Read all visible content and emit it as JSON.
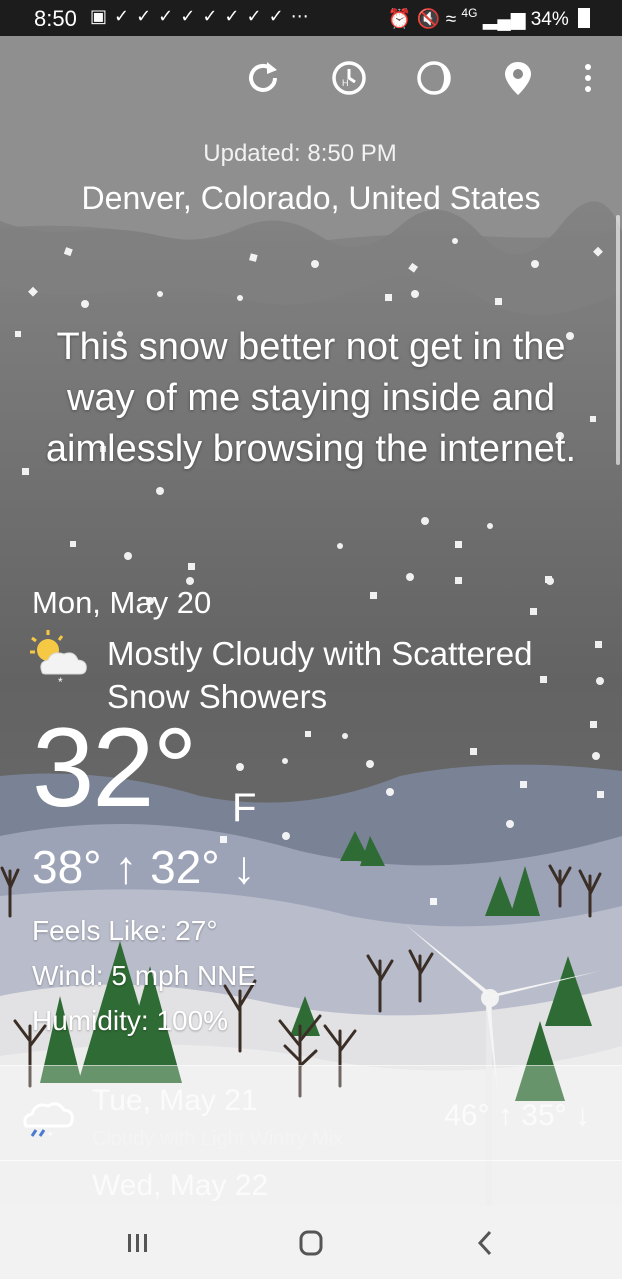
{
  "status_bar": {
    "time": "8:50",
    "network": "4G",
    "battery": "34%"
  },
  "toolbar": {
    "refresh_icon": "refresh-icon",
    "history_icon": "history-icon",
    "moon_icon": "moon-phase-icon",
    "location_icon": "location-pin-icon",
    "menu_icon": "more-vert-icon"
  },
  "header": {
    "updated": "Updated: 8:50 PM",
    "location": "Denver, Colorado, United States"
  },
  "quote": "This snow better not get in the way of me staying inside and aimlessly browsing the internet.",
  "current": {
    "date": "Mon, May 20",
    "condition": "Mostly Cloudy with Scattered Snow Showers",
    "temperature": "32°",
    "unit": "F",
    "hi_lo": "38° ↑ 32° ↓",
    "feels_like": "Feels Like: 27°",
    "wind": "Wind: 5 mph NNE",
    "humidity": "Humidity: 100%"
  },
  "forecast": [
    {
      "day": "Tue, May 21",
      "condition": "Cloudy with Light Wintry Mix",
      "temps": "46° ↑ 35° ↓",
      "icon": "cloud-wintry-mix-icon"
    },
    {
      "day": "Wed, May 22",
      "condition": "",
      "temps": "",
      "icon": "partly-sunny-icon"
    }
  ],
  "nav": {
    "recents": "recents-icon",
    "home": "home-icon",
    "back": "back-icon"
  }
}
